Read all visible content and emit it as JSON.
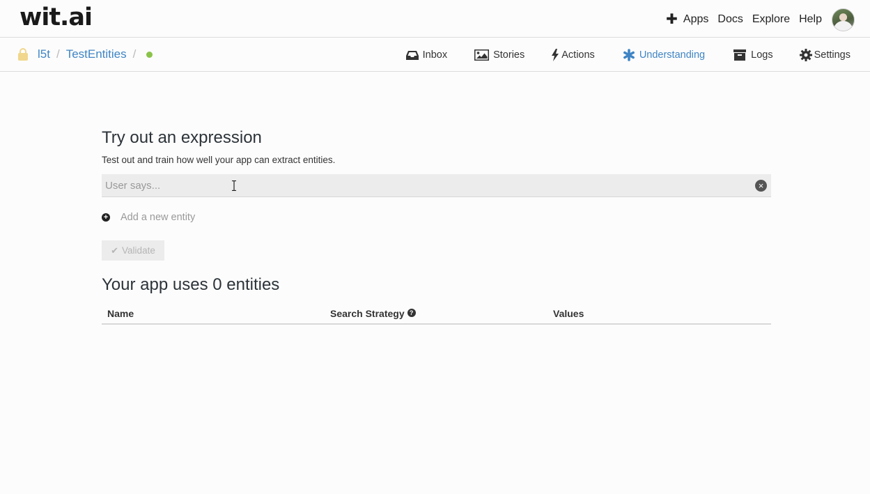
{
  "header": {
    "logo": "wit.ai",
    "nav": [
      {
        "label": "Apps"
      },
      {
        "label": "Docs"
      },
      {
        "label": "Explore"
      },
      {
        "label": "Help"
      }
    ]
  },
  "breadcrumb": {
    "user": "l5t",
    "app": "TestEntities",
    "separator": "/"
  },
  "app_nav": [
    {
      "label": "Inbox",
      "icon": "inbox-icon"
    },
    {
      "label": "Stories",
      "icon": "image-icon"
    },
    {
      "label": "Actions",
      "icon": "bolt-icon"
    },
    {
      "label": "Understanding",
      "icon": "asterisk-icon",
      "active": true
    },
    {
      "label": "Logs",
      "icon": "archive-icon"
    },
    {
      "label": "Settings",
      "icon": "gear-icon"
    }
  ],
  "colors": {
    "accent": "#3f85c5",
    "status_dot": "#8bc34a",
    "lock": "#f0d78c"
  },
  "main": {
    "title": "Try out an expression",
    "subtitle": "Test out and train how well your app can extract entities.",
    "input_placeholder": "User says...",
    "add_entity": "Add a new entity",
    "validate": "Validate",
    "entities_title": "Your app uses 0 entities",
    "table_headers": [
      "Name",
      "Search Strategy",
      "Values"
    ]
  }
}
